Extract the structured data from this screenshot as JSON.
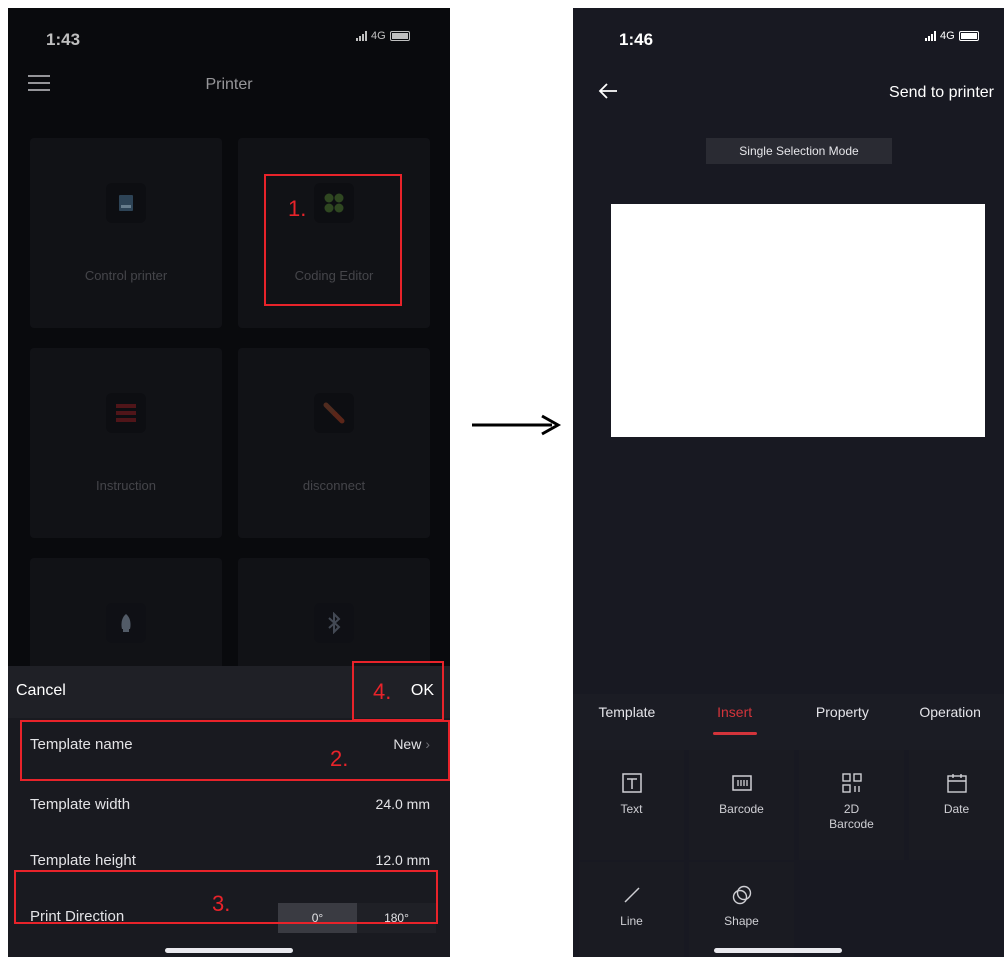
{
  "left_phone": {
    "status": {
      "time": "1:43",
      "network": "4G"
    },
    "header": {
      "title": "Printer"
    },
    "tiles": [
      {
        "label": "Control printer",
        "icon": "printer-icon"
      },
      {
        "label": "Coding Editor",
        "icon": "grid-icon"
      },
      {
        "label": "Instruction",
        "icon": "list-icon"
      },
      {
        "label": "disconnect",
        "icon": "unlink-icon"
      },
      {
        "label": "",
        "icon": "rocket-icon"
      },
      {
        "label": "",
        "icon": "bluetooth-icon"
      }
    ],
    "sheet": {
      "cancel_label": "Cancel",
      "ok_label": "OK",
      "rows": [
        {
          "label": "Template name",
          "value": "New"
        },
        {
          "label": "Template width",
          "value": "24.0 mm"
        },
        {
          "label": "Template height",
          "value": "12.0 mm"
        },
        {
          "label": "Print Direction",
          "options": [
            "0°",
            "180°"
          ],
          "selected": "0°"
        }
      ]
    },
    "callouts": [
      "1.",
      "2.",
      "3.",
      "4."
    ]
  },
  "right_phone": {
    "status": {
      "time": "1:46",
      "network": "4G"
    },
    "header": {
      "send_label": "Send to printer"
    },
    "mode_badge": "Single Selection Mode",
    "tabs": [
      "Template",
      "Insert",
      "Property",
      "Operation"
    ],
    "active_tab": "Insert",
    "tools": [
      {
        "label": "Text",
        "icon": "text-icon"
      },
      {
        "label": "Barcode",
        "icon": "barcode-icon"
      },
      {
        "label": "2D\nBarcode",
        "icon": "qr-code-icon"
      },
      {
        "label": "Date",
        "icon": "calendar-icon"
      },
      {
        "label": "Line",
        "icon": "line-icon"
      },
      {
        "label": "Shape",
        "icon": "shape-icon"
      }
    ]
  },
  "colors": {
    "accent_red": "#e8232a",
    "tab_active": "#d3343b",
    "bg_dark": "#0d0e12",
    "panel": "#191a20"
  }
}
